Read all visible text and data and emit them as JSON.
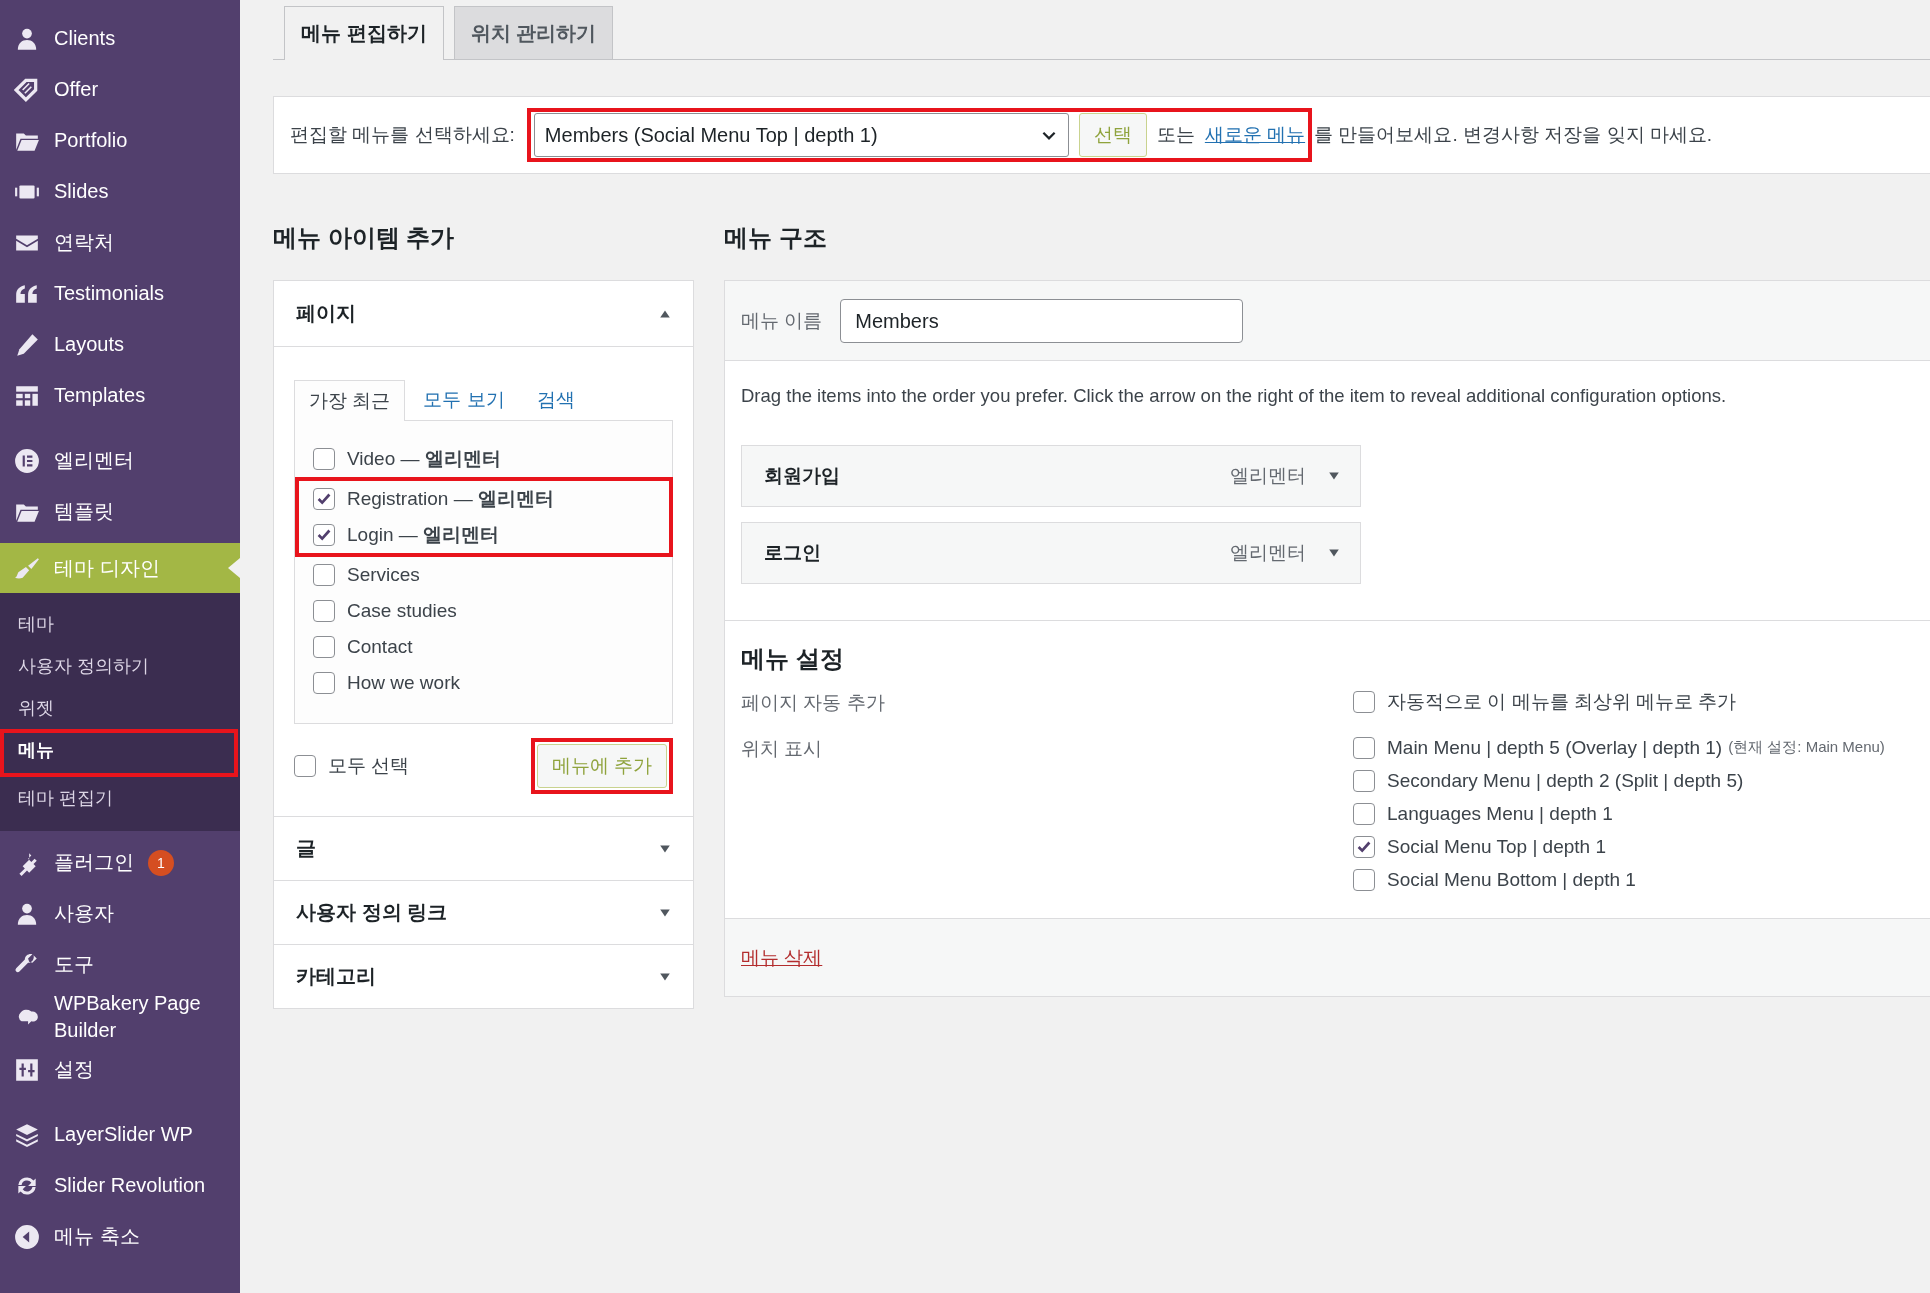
{
  "sidebar": {
    "groups": [
      {
        "items": [
          {
            "label": "Clients",
            "selected": false
          },
          {
            "label": "Offer",
            "selected": false
          },
          {
            "label": "Portfolio",
            "selected": false
          },
          {
            "label": "Slides",
            "selected": false
          },
          {
            "label": "연락처",
            "selected": false
          },
          {
            "label": "Testimonials",
            "selected": false
          },
          {
            "label": "Layouts",
            "selected": false
          },
          {
            "label": "Templates",
            "selected": false
          }
        ]
      },
      {
        "items": [
          {
            "label": "엘리멘터",
            "selected": false
          },
          {
            "label": "템플릿",
            "selected": false
          },
          {
            "label": "테마 디자인",
            "selected": true,
            "children": [
              {
                "label": "테마",
                "selected": false,
                "highlighted": false
              },
              {
                "label": "사용자 정의하기",
                "selected": false,
                "highlighted": false
              },
              {
                "label": "위젯",
                "selected": false,
                "highlighted": false
              },
              {
                "label": "메뉴",
                "selected": true,
                "highlighted": true
              },
              {
                "label": "테마 편집기",
                "selected": false,
                "highlighted": false
              }
            ]
          },
          {
            "label": "플러그인",
            "selected": false,
            "badge": "1"
          },
          {
            "label": "사용자",
            "selected": false
          },
          {
            "label": "도구",
            "selected": false
          },
          {
            "label": "WPBakery Page Builder",
            "selected": false
          },
          {
            "label": "설정",
            "selected": false
          }
        ]
      },
      {
        "items": [
          {
            "label": "LayerSlider WP",
            "selected": false
          },
          {
            "label": "Slider Revolution",
            "selected": false
          },
          {
            "label": "메뉴 축소",
            "selected": false
          }
        ]
      }
    ]
  },
  "tabs": [
    {
      "label": "메뉴 편집하기",
      "selected": true
    },
    {
      "label": "위치 관리하기",
      "selected": false
    }
  ],
  "menu_select": {
    "label": "편집할 메뉴를 선택하세요:",
    "value": "Members (Social Menu Top | depth 1)",
    "button": "선택",
    "or_text": "또는",
    "link": "새로운 메뉴",
    "after_text": "를 만들어보세요. 변경사항 저장을 잊지 마세요.",
    "highlighted": true
  },
  "add_items": {
    "heading": "메뉴 아이템 추가",
    "sections": [
      {
        "title": "페이지",
        "expanded": true,
        "tabs": [
          {
            "label": "가장 최근",
            "selected": true
          },
          {
            "label": "모두 보기",
            "selected": false
          },
          {
            "label": "검색",
            "selected": false
          }
        ],
        "items": [
          {
            "label": "Video — **엘리멘터**",
            "checked": false,
            "highlighted": false
          },
          {
            "label": "Registration — **엘리멘터**",
            "checked": true,
            "highlighted": true
          },
          {
            "label": "Login — **엘리멘터**",
            "checked": true,
            "highlighted": true
          },
          {
            "label": "Services",
            "checked": false,
            "highlighted": false
          },
          {
            "label": "Case studies",
            "checked": false,
            "highlighted": false
          },
          {
            "label": "Contact",
            "checked": false,
            "highlighted": false
          },
          {
            "label": "How we work",
            "checked": false,
            "highlighted": false
          }
        ],
        "select_all": {
          "label": "모두 선택",
          "checked": false
        },
        "add_button": {
          "label": "메뉴에 추가",
          "highlighted": true
        }
      },
      {
        "title": "글",
        "expanded": false
      },
      {
        "title": "사용자 정의 링크",
        "expanded": false
      },
      {
        "title": "카테고리",
        "expanded": false
      }
    ]
  },
  "structure": {
    "heading": "메뉴 구조",
    "name_label": "메뉴 이름",
    "name_value": "Members",
    "instructions": "Drag the items into the order you prefer. Click the arrow on the right of the item to reveal additional configuration options.",
    "items": [
      {
        "title": "회원가입",
        "type_label": "엘리멘터"
      },
      {
        "title": "로그인",
        "type_label": "엘리멘터"
      }
    ],
    "settings": {
      "heading": "메뉴 설정",
      "rows": [
        {
          "label": "페이지 자동 추가",
          "options": [
            {
              "label": "자동적으로 이 메뉴를 최상위 메뉴로 추가",
              "checked": false
            }
          ]
        },
        {
          "label": "위치 표시",
          "options": [
            {
              "label": "Main Menu | depth 5 (Overlay | depth 1)",
              "note": "(현재 설정: Main Menu)",
              "checked": false
            },
            {
              "label": "Secondary Menu | depth 2 (Split | depth 5)",
              "checked": false
            },
            {
              "label": "Languages Menu | depth 1",
              "checked": false
            },
            {
              "label": "Social Menu Top | depth 1",
              "checked": true
            },
            {
              "label": "Social Menu Bottom | depth 1",
              "checked": false
            }
          ]
        }
      ]
    },
    "delete_link": "메뉴 삭제"
  }
}
